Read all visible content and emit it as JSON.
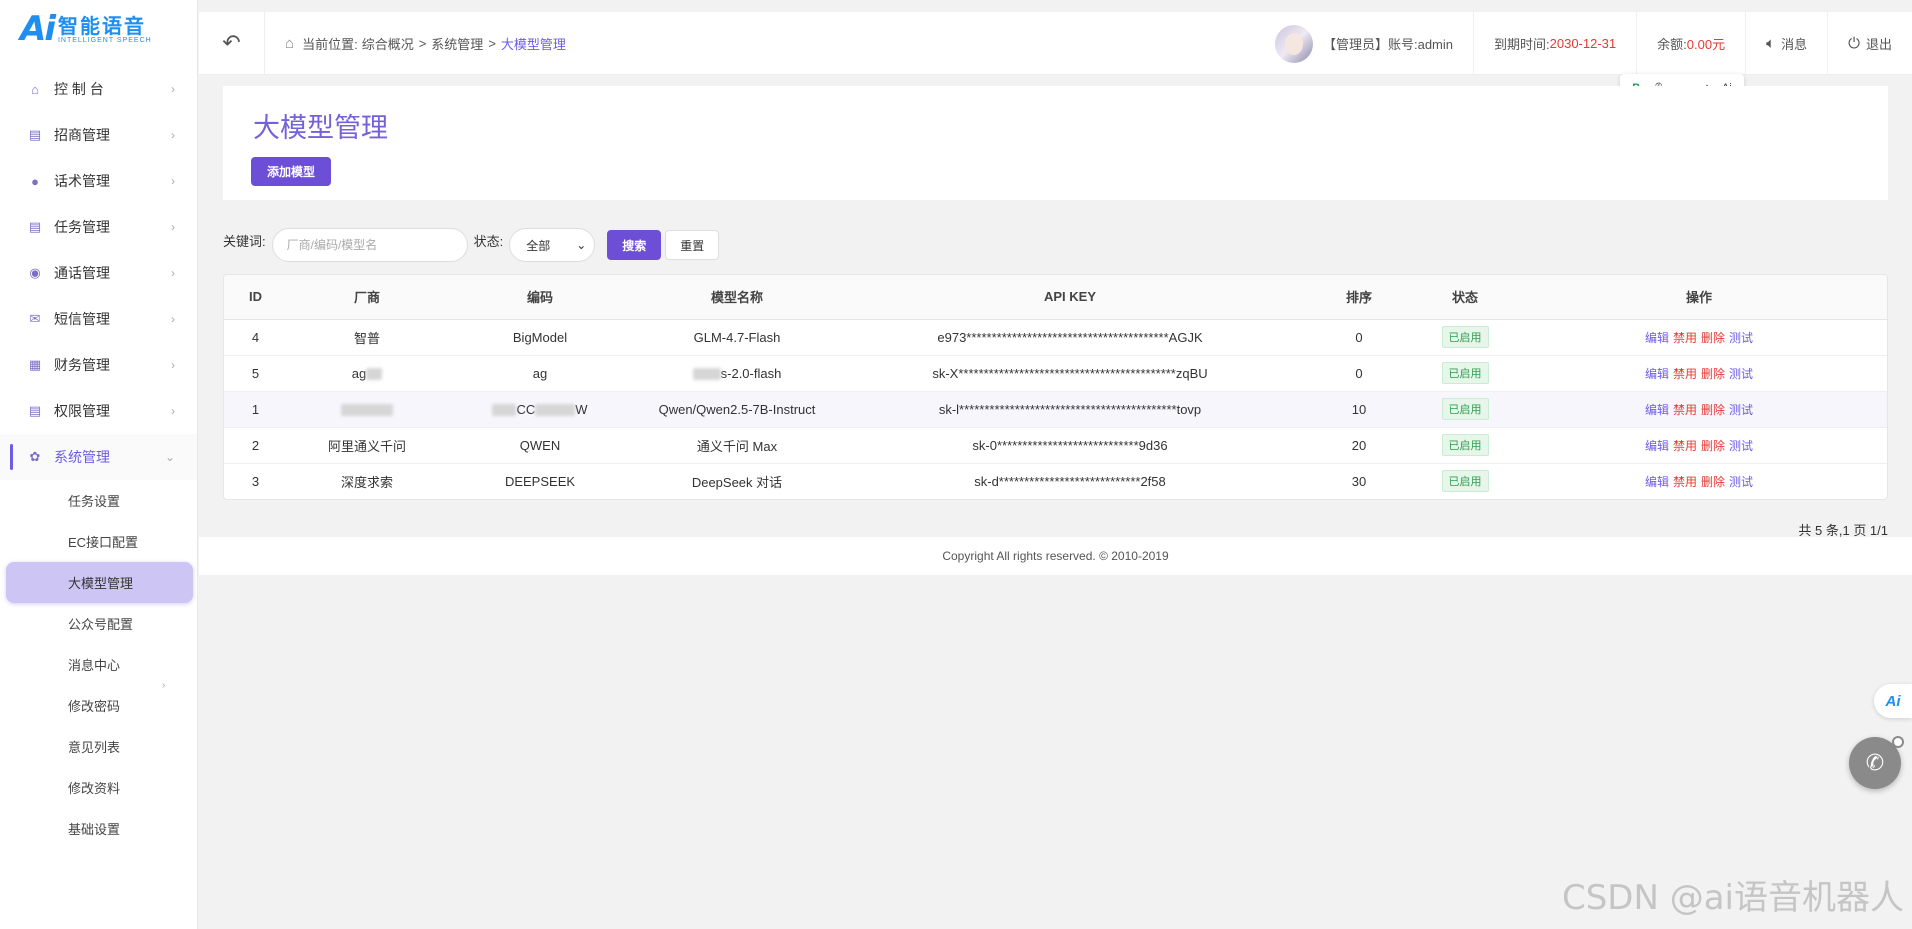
{
  "logo": {
    "mark": "Ai",
    "cn": "智能语音",
    "en": "INTELLIGENT SPEECH"
  },
  "sidebar": {
    "items": [
      {
        "label": "控 制 台",
        "icon": "home-icon"
      },
      {
        "label": "招商管理",
        "icon": "clipboard-icon"
      },
      {
        "label": "话术管理",
        "icon": "microphone-icon"
      },
      {
        "label": "任务管理",
        "icon": "clipboard-icon"
      },
      {
        "label": "通话管理",
        "icon": "phone-icon"
      },
      {
        "label": "短信管理",
        "icon": "mail-icon"
      },
      {
        "label": "财务管理",
        "icon": "finance-icon"
      },
      {
        "label": "权限管理",
        "icon": "clipboard-icon"
      },
      {
        "label": "系统管理",
        "icon": "gear-icon"
      }
    ],
    "sub_items": [
      {
        "label": "任务设置"
      },
      {
        "label": "EC接口配置"
      },
      {
        "label": "大模型管理"
      },
      {
        "label": "公众号配置"
      },
      {
        "label": "消息中心"
      },
      {
        "label": "修改密码"
      },
      {
        "label": "意见列表"
      },
      {
        "label": "修改资料"
      },
      {
        "label": "基础设置"
      }
    ]
  },
  "header": {
    "crumb_prefix": "当前位置:",
    "crumb_1": "综合概况",
    "crumb_2": "系统管理",
    "crumb_current": "大模型管理",
    "crumb_sep": ">",
    "user_label": "【管理员】账号:admin",
    "expire_label": "到期时间:",
    "expire_value": "2030-12-31",
    "balance_label": "余额:",
    "balance_value": "0.00元",
    "message_label": "消息",
    "logout_label": "退出"
  },
  "float_tools": {
    "t5": "Ai"
  },
  "page": {
    "title": "大模型管理",
    "add_button": "添加模型"
  },
  "search": {
    "keyword_label": "关键词:",
    "keyword_placeholder": "厂商/编码/模型名",
    "status_label": "状态:",
    "status_value": "全部",
    "search_button": "搜索",
    "reset_button": "重置"
  },
  "table": {
    "headers": [
      "ID",
      "厂商",
      "编码",
      "模型名称",
      "API KEY",
      "排序",
      "状态",
      "操作"
    ],
    "rows": [
      {
        "id": "4",
        "vendor": "智普",
        "code": "BigModel",
        "model": "GLM-4.7-Flash",
        "api_key": "e973****************************************AGJK",
        "sort": "0",
        "status": "已启用"
      },
      {
        "id": "5",
        "vendor": "ag",
        "code": "ag",
        "model": "s-2.0-flash",
        "api_key": "sk-X*******************************************zqBU",
        "sort": "0",
        "status": "已启用"
      },
      {
        "id": "1",
        "vendor": "",
        "code": "CC",
        "model": "Qwen/Qwen2.5-7B-Instruct",
        "api_key": "sk-l*******************************************tovp",
        "sort": "10",
        "status": "已启用"
      },
      {
        "id": "2",
        "vendor": "阿里通义千问",
        "code": "QWEN",
        "model": "通义千问 Max",
        "api_key": "sk-0****************************9d36",
        "sort": "20",
        "status": "已启用"
      },
      {
        "id": "3",
        "vendor": "深度求索",
        "code": "DEEPSEEK",
        "model": "DeepSeek 对话",
        "api_key": "sk-d****************************2f58",
        "sort": "30",
        "status": "已启用"
      }
    ],
    "ops": {
      "edit": "编辑",
      "disable": "禁用",
      "delete": "删除",
      "test": "测试"
    }
  },
  "pager": "共 5 条,1 页 1/1",
  "footer": "Copyright All rights reserved. © 2010-2019",
  "ai_float": "Ai",
  "watermark": "CSDN @ai语音机器人"
}
